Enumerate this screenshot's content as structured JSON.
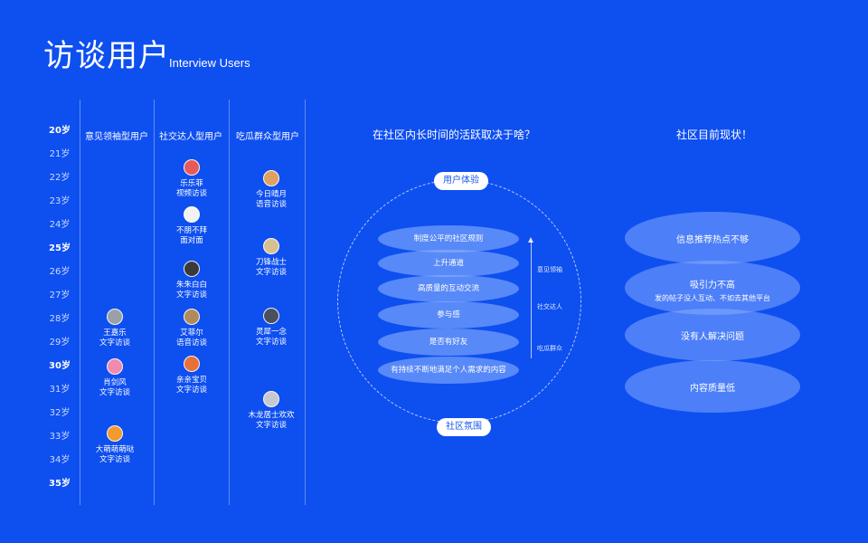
{
  "header": {
    "title": "访谈用户",
    "subtitle": "Interview Users"
  },
  "ages": [
    "20岁",
    "21岁",
    "22岁",
    "23岁",
    "24岁",
    "25岁",
    "26岁",
    "27岁",
    "28岁",
    "29岁",
    "30岁",
    "31岁",
    "32岁",
    "33岁",
    "34岁",
    "35岁"
  ],
  "columns": [
    {
      "title": "意见领袖型用户",
      "users": [
        {
          "name": "王嘉乐",
          "type": "文字访谈",
          "color": "#9aa0a8"
        },
        {
          "name": "肖剑风",
          "type": "文字访谈",
          "color": "#f08ab0"
        },
        {
          "name": "大萌萌萌哒",
          "type": "文字访谈",
          "color": "#f29a30"
        }
      ]
    },
    {
      "title": "社交达人型用户",
      "users": [
        {
          "name": "乐乐菲",
          "type": "视频访谈",
          "color": "#e85a5a"
        },
        {
          "name": "不朋不拜",
          "type": "面对面",
          "color": "#f2f2f2"
        },
        {
          "name": "朱朱白白",
          "type": "文字访谈",
          "color": "#3a3a3a"
        },
        {
          "name": "艾菲尔",
          "type": "语音访谈",
          "color": "#b08a5a"
        },
        {
          "name": "亲亲宝贝",
          "type": "文字访谈",
          "color": "#e8703a"
        }
      ]
    },
    {
      "title": "吃瓜群众型用户",
      "users": [
        {
          "name": "今日晴月",
          "type": "语音访谈",
          "color": "#e0a060"
        },
        {
          "name": "刀锋战士",
          "type": "文字访谈",
          "color": "#d8c090"
        },
        {
          "name": "灵犀一念",
          "type": "文字访谈",
          "color": "#4a5060"
        },
        {
          "name": "木龙居士欢欢",
          "type": "文字访谈",
          "color": "#c8c8d0"
        }
      ]
    }
  ],
  "question": {
    "title": "在社区内长时间的活跃取决于啥？",
    "top_label": "用户体验",
    "bottom_label": "社区氛围",
    "layers": [
      "制度公平的社区规则",
      "上升通道",
      "高质量的互动交流",
      "参与感",
      "是否有好友",
      "有持续不断地满足个人需求的内容"
    ],
    "side_labels": [
      "意见领袖",
      "社交达人",
      "吃瓜群众"
    ]
  },
  "status": {
    "title": "社区目前现状！",
    "items": [
      {
        "title": "信息推荐热点不够",
        "sub": ""
      },
      {
        "title": "吸引力不高",
        "sub": "发的帖子没人互动、不如去其他平台"
      },
      {
        "title": "没有人解决问题",
        "sub": ""
      },
      {
        "title": "内容质量低",
        "sub": ""
      }
    ]
  }
}
